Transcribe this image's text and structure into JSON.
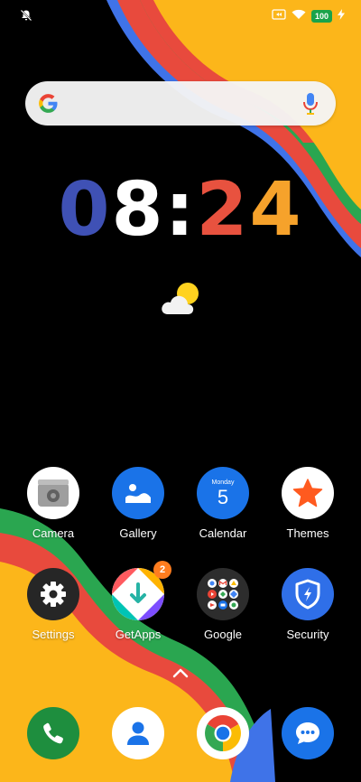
{
  "status_bar": {
    "left_icon": "notifications-muted-icon",
    "battery_level": "100",
    "icons": [
      "cast-icon",
      "wifi-icon",
      "battery-icon",
      "charging-bolt-icon"
    ]
  },
  "search_widget": {
    "logo_icon": "google-g-icon",
    "voice_icon": "microphone-icon"
  },
  "clock": {
    "h1": "0",
    "h2": "8",
    "sep": ":",
    "m1": "2",
    "m2": "4"
  },
  "weather": {
    "icon": "partly-cloudy-icon"
  },
  "calendar_icon": {
    "day_name": "Monday",
    "day_number": "5"
  },
  "apps_row1": [
    {
      "label": "Camera",
      "icon": "camera-icon"
    },
    {
      "label": "Gallery",
      "icon": "gallery-icon"
    },
    {
      "label": "Calendar",
      "icon": "calendar-icon"
    },
    {
      "label": "Themes",
      "icon": "star-icon"
    }
  ],
  "apps_row2": [
    {
      "label": "Settings",
      "icon": "gear-icon"
    },
    {
      "label": "GetApps",
      "icon": "getapps-icon",
      "badge": "2"
    },
    {
      "label": "Google",
      "icon": "google-folder-icon"
    },
    {
      "label": "Security",
      "icon": "shield-bolt-icon"
    }
  ],
  "dock": [
    {
      "icon": "phone-icon"
    },
    {
      "icon": "contacts-icon"
    },
    {
      "icon": "chrome-icon"
    },
    {
      "icon": "messages-icon"
    }
  ],
  "colors": {
    "clock_0": "#3f51b5",
    "clock_8": "#ffffff",
    "clock_colon": "#ffffff",
    "clock_2": "#e8523f",
    "clock_4": "#f6a22b",
    "wall_yellow": "#fcb61a",
    "wall_red": "#e84a3d",
    "wall_blue": "#3f73e8",
    "wall_green": "#2aa650"
  }
}
